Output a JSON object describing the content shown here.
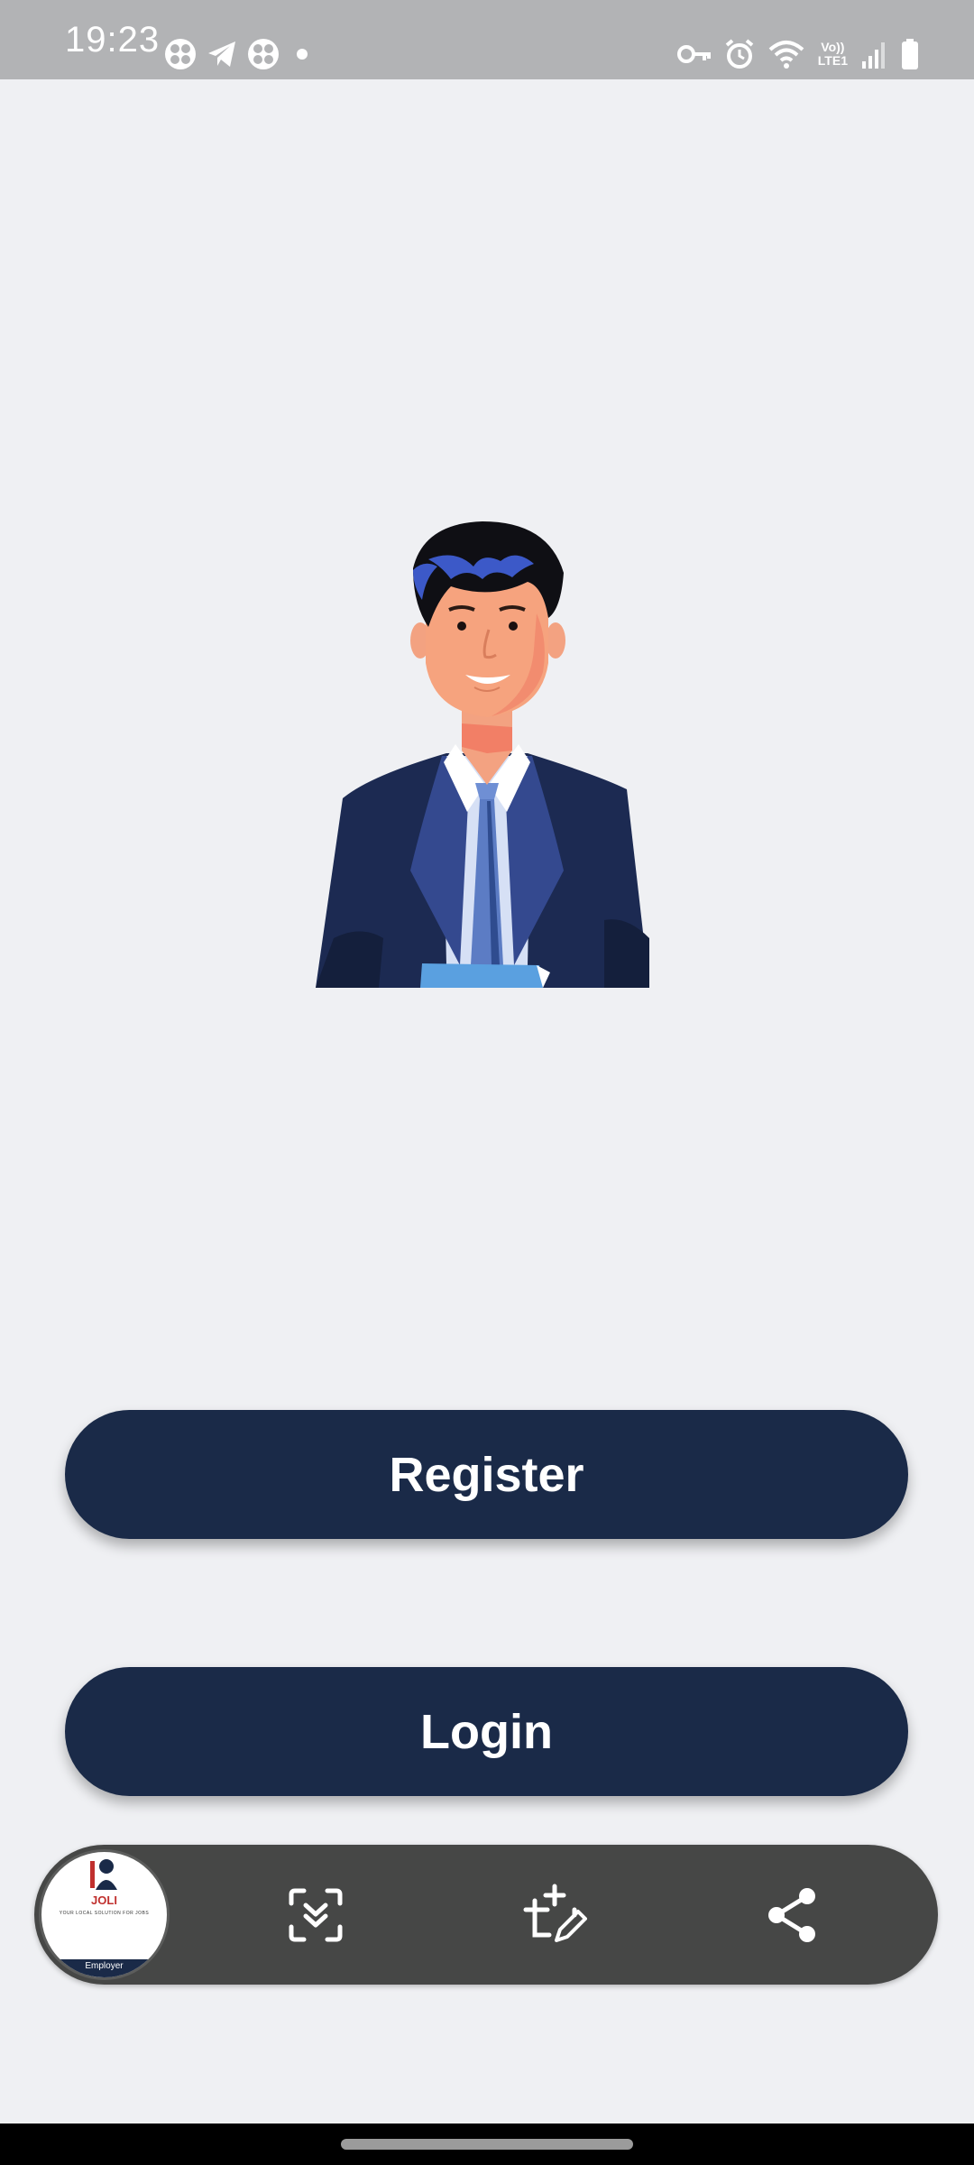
{
  "status_bar": {
    "time": "19:23",
    "lte_top": "Vo))",
    "lte_bottom": "LTE1",
    "icons": [
      "fan-icon",
      "telegram-icon",
      "fan-icon",
      "dot-icon",
      "vpn-key-icon",
      "alarm-icon",
      "wifi-icon",
      "volte-icon",
      "signal-icon",
      "battery-icon"
    ]
  },
  "main": {
    "illustration": "businessman-illustration",
    "register_label": "Register",
    "login_label": "Login"
  },
  "screenshot_toolbar": {
    "thumbnail": {
      "title": "JOLI",
      "subtitle": "YOUR LOCAL SOLUTION FOR JOBS",
      "footer": "Employer"
    },
    "actions": [
      "scroll-capture-icon",
      "crop-edit-icon",
      "share-icon"
    ]
  },
  "colors": {
    "background": "#eff0f3",
    "status_bar": "#b2b3b5",
    "button": "#1a2a48",
    "button_text": "#ffffff",
    "toolbar": "#464746",
    "nav_bar": "#000000"
  }
}
